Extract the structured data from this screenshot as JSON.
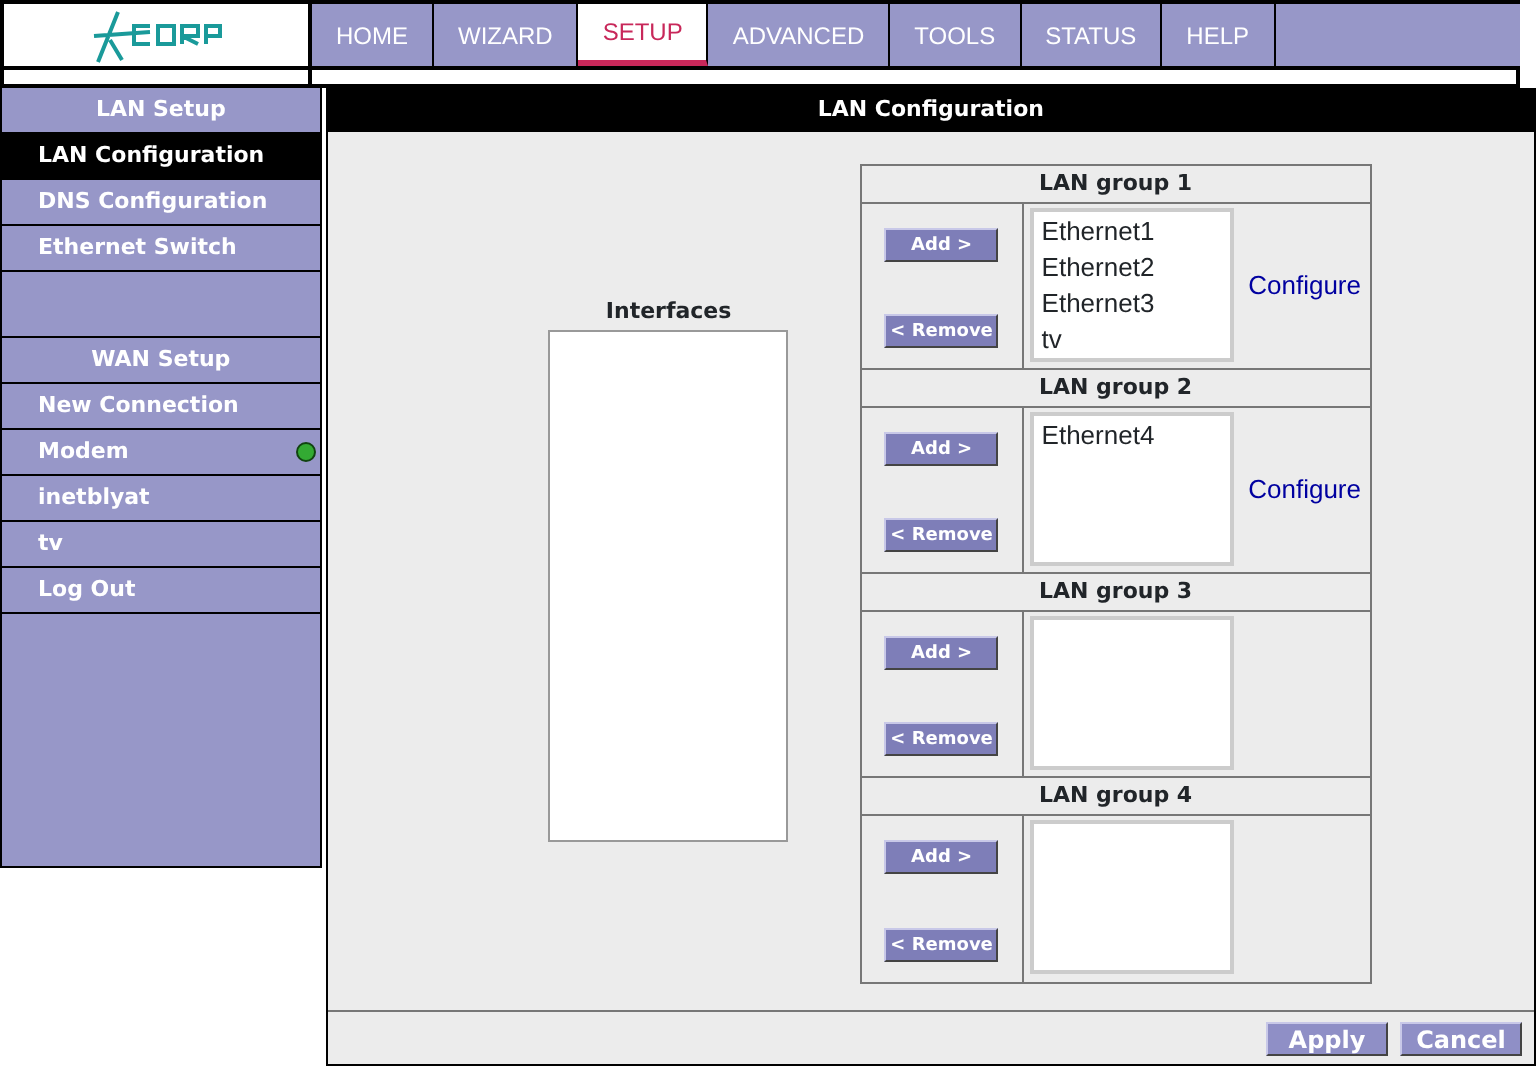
{
  "nav": {
    "tabs": [
      {
        "label": "HOME",
        "selected": false
      },
      {
        "label": "WIZARD",
        "selected": false
      },
      {
        "label": "SETUP",
        "selected": true
      },
      {
        "label": "ADVANCED",
        "selected": false
      },
      {
        "label": "TOOLS",
        "selected": false
      },
      {
        "label": "STATUS",
        "selected": false
      },
      {
        "label": "HELP",
        "selected": false
      }
    ]
  },
  "sidebar": {
    "sections": [
      {
        "title": "LAN Setup",
        "items": [
          {
            "label": "LAN Configuration",
            "selected": true
          },
          {
            "label": "DNS Configuration",
            "selected": false
          },
          {
            "label": "Ethernet Switch",
            "selected": false
          }
        ]
      },
      {
        "title": "WAN Setup",
        "items": [
          {
            "label": "New Connection",
            "selected": false
          },
          {
            "label": "Modem",
            "selected": false,
            "color": "#33aa33"
          },
          {
            "label": "inetblyat",
            "selected": false
          },
          {
            "label": "tv",
            "selected": false
          },
          {
            "label": "Log Out",
            "selected": false
          }
        ]
      }
    ]
  },
  "panel": {
    "title": "LAN Configuration",
    "interfaces": {
      "label": "Interfaces"
    },
    "groups": [
      {
        "title": "LAN group 1",
        "add": "Add >",
        "remove": "< Remove",
        "members": [
          "Ethernet1",
          "Ethernet2",
          "Ethernet3",
          "tv"
        ],
        "configure": "Configure"
      },
      {
        "title": "LAN group 2",
        "add": "Add >",
        "remove": "< Remove",
        "members": [
          "Ethernet4"
        ],
        "configure": "Configure"
      },
      {
        "title": "LAN group 3",
        "add": "Add >",
        "remove": "< Remove"
      },
      {
        "title": "LAN group 4",
        "add": "Add >",
        "remove": "< Remove"
      }
    ],
    "buttons": [
      "Apply",
      "Cancel"
    ]
  }
}
